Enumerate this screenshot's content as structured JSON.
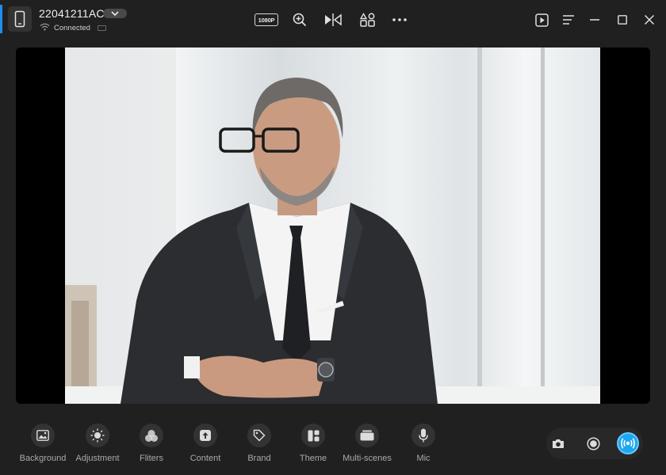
{
  "device": {
    "name": "22041211AC",
    "status": "Connected"
  },
  "toolbar": {
    "resolution": "1080P"
  },
  "tools": [
    {
      "label": "Background",
      "icon": "image-icon"
    },
    {
      "label": "Adjustment",
      "icon": "brightness-icon"
    },
    {
      "label": "Fliters",
      "icon": "filters-icon"
    },
    {
      "label": "Content",
      "icon": "upload-content-icon"
    },
    {
      "label": "Brand",
      "icon": "tag-icon"
    },
    {
      "label": "Theme",
      "icon": "theme-layout-icon"
    },
    {
      "label": "Multi-scenes",
      "icon": "scenes-icon"
    },
    {
      "label": "Mic",
      "icon": "microphone-icon"
    }
  ],
  "colors": {
    "accent": "#1e8ff0",
    "live": "#1ea7ef",
    "background": "#202020"
  }
}
